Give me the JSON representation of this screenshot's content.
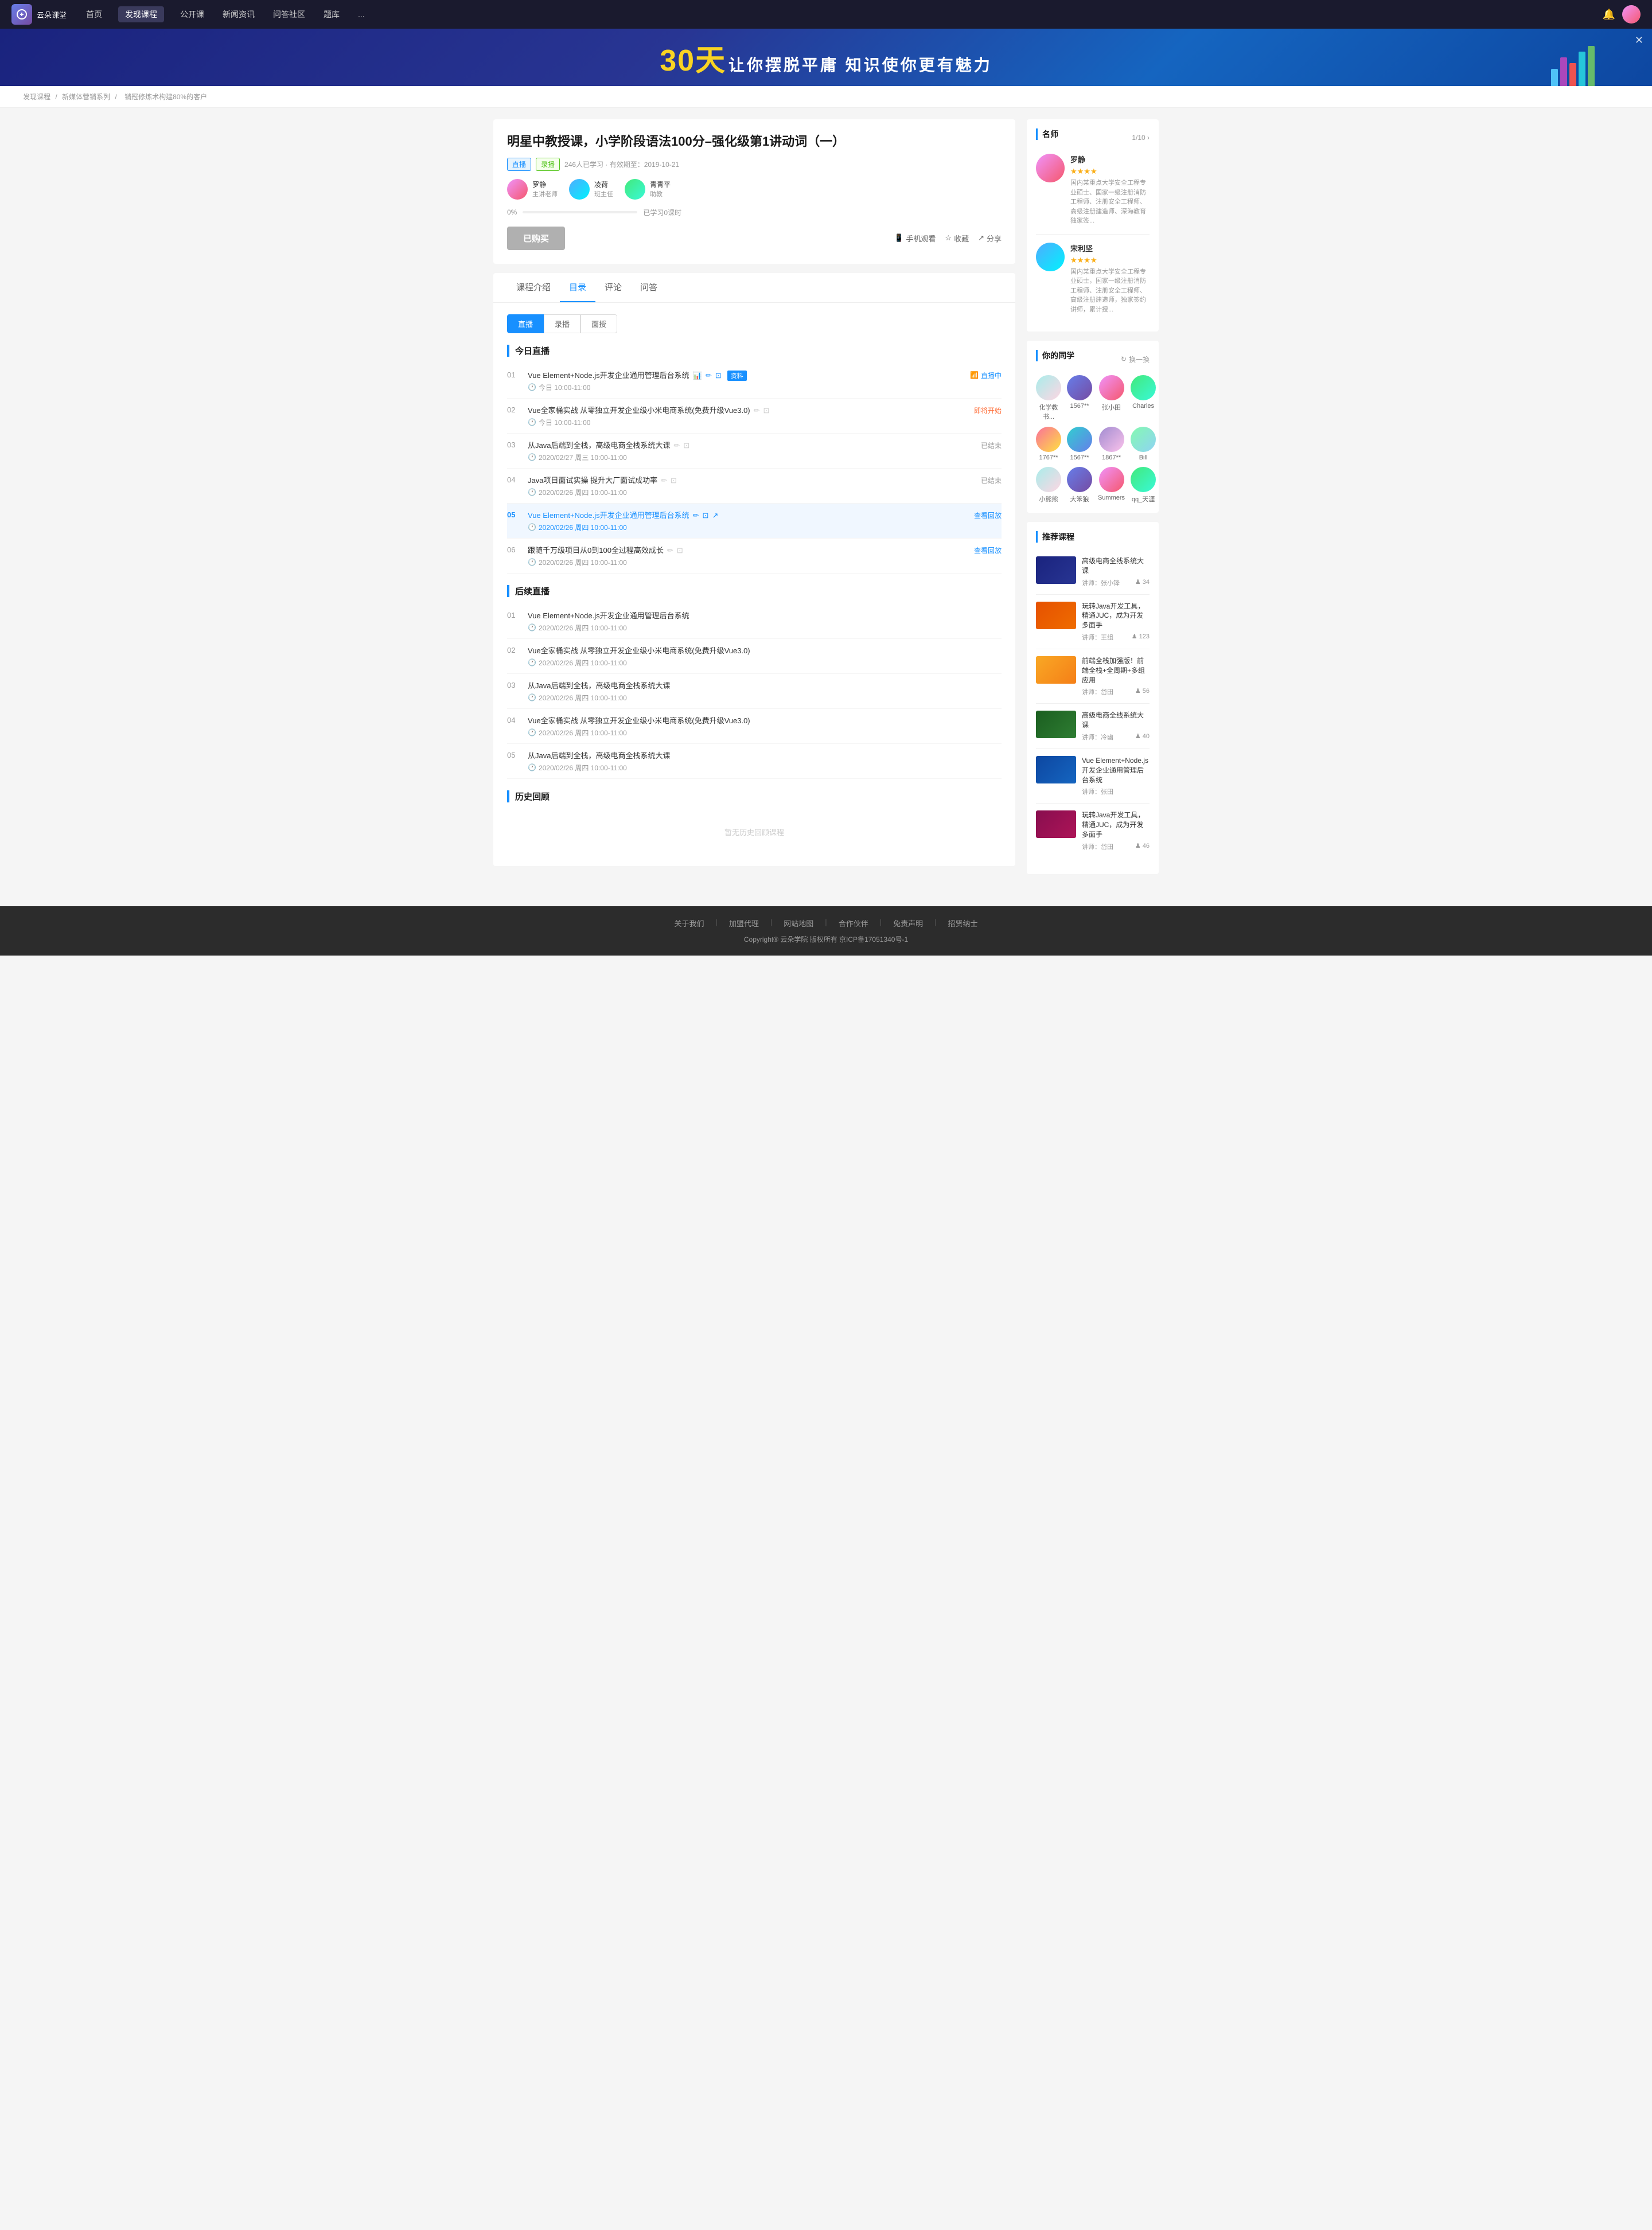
{
  "nav": {
    "logo_text": "云朵课堂",
    "items": [
      {
        "label": "首页",
        "active": false
      },
      {
        "label": "发现课程",
        "active": true
      },
      {
        "label": "公开课",
        "active": false
      },
      {
        "label": "新闻资讯",
        "active": false
      },
      {
        "label": "问答社区",
        "active": false
      },
      {
        "label": "题库",
        "active": false
      },
      {
        "label": "...",
        "active": false
      }
    ]
  },
  "banner": {
    "days": "30天",
    "slogan": "让你摆脱平庸  知识使你更有魅力",
    "close_icon": "✕"
  },
  "breadcrumb": {
    "items": [
      "发现课程",
      "新媒体营销系列",
      "销冠修炼术构建80%的客户"
    ]
  },
  "course": {
    "title": "明星中教授课，小学阶段语法100分–强化级第1讲动词（一）",
    "tag_live": "直播",
    "tag_record": "录播",
    "meta": "246人已学习 · 有效期至：2019-10-21",
    "instructors": [
      {
        "name": "罗静",
        "role": "主讲老师"
      },
      {
        "name": "凌荷",
        "role": "班主任"
      },
      {
        "name": "青青平",
        "role": "助教"
      }
    ],
    "progress": "0%",
    "progress_label": "已学习0课时",
    "btn_buy": "已购买",
    "btn_mobile": "手机观看",
    "btn_collect": "收藏",
    "btn_share": "分享"
  },
  "tabs": {
    "items": [
      "课程介绍",
      "目录",
      "评论",
      "问答"
    ],
    "active": "目录"
  },
  "sub_tabs": {
    "items": [
      "直播",
      "录播",
      "面授"
    ],
    "active": "直播"
  },
  "today_live": {
    "title": "今日直播",
    "lessons": [
      {
        "num": "01",
        "name": "Vue Element+Node.js开发企业通用管理后台系统",
        "time": "今日 10:00-11:00",
        "status": "直播中",
        "status_type": "live",
        "has_material": true,
        "material_label": "资料"
      },
      {
        "num": "02",
        "name": "Vue全家桶实战 从零独立开发企业级小米电商系统(免费升级Vue3.0)",
        "time": "今日 10:00-11:00",
        "status": "即将开始",
        "status_type": "soon"
      },
      {
        "num": "03",
        "name": "从Java后端到全栈，高级电商全栈系统大课",
        "time": "2020/02/27 周三 10:00-11:00",
        "status": "已结束",
        "status_type": "ended"
      },
      {
        "num": "04",
        "name": "Java项目面试实操 提升大厂面试成功率",
        "time": "2020/02/26 周四 10:00-11:00",
        "status": "已结束",
        "status_type": "ended"
      },
      {
        "num": "05",
        "name": "Vue Element+Node.js开发企业通用管理后台系统",
        "time": "2020/02/26 周四 10:00-11:00",
        "status": "查看回放",
        "status_type": "replay",
        "is_highlight": true
      },
      {
        "num": "06",
        "name": "跟随千万级项目从0到100全过程高效成长",
        "time": "2020/02/26 周四 10:00-11:00",
        "status": "查看回放",
        "status_type": "replay"
      }
    ]
  },
  "future_live": {
    "title": "后续直播",
    "lessons": [
      {
        "num": "01",
        "name": "Vue Element+Node.js开发企业通用管理后台系统",
        "time": "2020/02/26 周四 10:00-11:00"
      },
      {
        "num": "02",
        "name": "Vue全家桶实战 从零独立开发企业级小米电商系统(免费升级Vue3.0)",
        "time": "2020/02/26 周四 10:00-11:00"
      },
      {
        "num": "03",
        "name": "从Java后端到全栈，高级电商全栈系统大课",
        "time": "2020/02/26 周四 10:00-11:00"
      },
      {
        "num": "04",
        "name": "Vue全家桶实战 从零独立开发企业级小米电商系统(免费升级Vue3.0)",
        "time": "2020/02/26 周四 10:00-11:00"
      },
      {
        "num": "05",
        "name": "从Java后端到全栈，高级电商全栈系统大课",
        "time": "2020/02/26 周四 10:00-11:00"
      }
    ]
  },
  "history_review": {
    "title": "历史回顾",
    "empty_text": "暂无历史回顾课程"
  },
  "sidebar": {
    "teachers_title": "名师",
    "teacher_nav": "1/10 ›",
    "teachers": [
      {
        "name": "罗静",
        "stars": "★★★★",
        "desc": "国内某重点大学安全工程专业硕士、国家一级注册消防工程师、注册安全工程师、高级注册建造师、深海教育独家签..."
      },
      {
        "name": "宋利坚",
        "stars": "★★★★",
        "desc": "国内某重点大学安全工程专业硕士，国家一级注册消防工程师、注册安全工程师、高级注册建造师，独家签约讲师，累计授..."
      }
    ],
    "classmates_title": "你的同学",
    "classmates_change": "换一换",
    "classmates": [
      {
        "name": "化学教书...",
        "color": "ca1"
      },
      {
        "name": "1567**",
        "color": "ca2"
      },
      {
        "name": "张小田",
        "color": "ca3"
      },
      {
        "name": "Charles",
        "color": "ca4"
      },
      {
        "name": "1767**",
        "color": "ca5"
      },
      {
        "name": "1567**",
        "color": "ca6"
      },
      {
        "name": "1867**",
        "color": "ca7"
      },
      {
        "name": "Bill",
        "color": "ca8"
      },
      {
        "name": "小熊熊",
        "color": "ca1"
      },
      {
        "name": "大笨狼",
        "color": "ca2"
      },
      {
        "name": "Summers",
        "color": "ca3"
      },
      {
        "name": "qq_天涯",
        "color": "ca4"
      }
    ],
    "recommend_title": "推荐课程",
    "recommends": [
      {
        "title": "高级电商全线系统大课",
        "instructor": "讲师：张小锋",
        "students": "34",
        "color": "rt1"
      },
      {
        "title": "玩转Java开发工具，精通JUC，成为开发多面手",
        "instructor": "讲师：王组",
        "students": "123",
        "color": "rt2"
      },
      {
        "title": "前端全栈加强版！前端全栈+全周期+多组应用",
        "instructor": "讲师：岱田",
        "students": "56",
        "color": "rt3"
      },
      {
        "title": "高级电商全线系统大课",
        "instructor": "讲师：冷幽",
        "students": "40",
        "color": "rt4"
      },
      {
        "title": "Vue Element+Node.js开发企业通用管理后台系统",
        "instructor": "讲师：张田",
        "students": "",
        "color": "rt5"
      },
      {
        "title": "玩转Java开发工具，精通JUC，成为开发多面手",
        "instructor": "讲师：岱田",
        "students": "46",
        "color": "rt6"
      }
    ]
  },
  "footer": {
    "links": [
      "关于我们",
      "加盟代理",
      "网站地图",
      "合作伙伴",
      "免责声明",
      "招贤纳士"
    ],
    "copyright": "Copyright® 云朵学院  版权所有  京ICP备17051340号-1"
  }
}
